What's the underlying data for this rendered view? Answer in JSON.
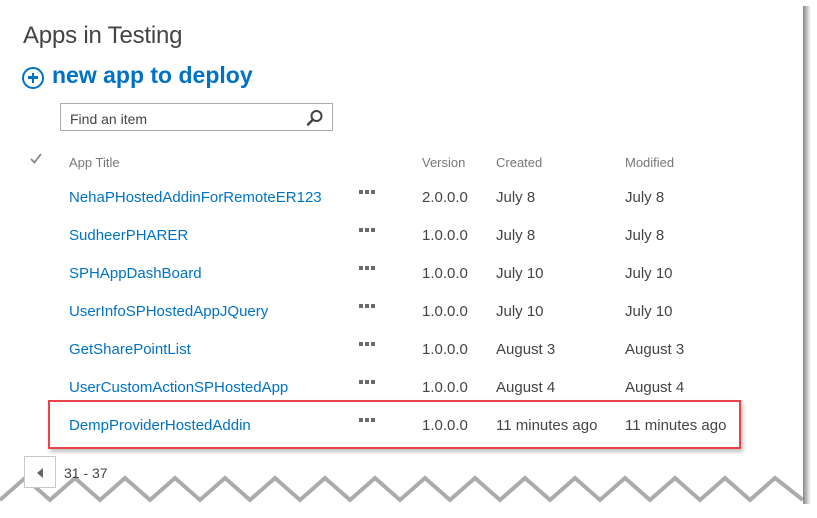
{
  "page": {
    "title": "Apps in Testing",
    "new_app_label": "new app to deploy"
  },
  "search": {
    "placeholder": "Find an item",
    "value": ""
  },
  "table": {
    "columns": {
      "title": "App Title",
      "version": "Version",
      "created": "Created",
      "modified": "Modified"
    },
    "rows": [
      {
        "title": "NehaPHostedAddinForRemoteER123",
        "version": "2.0.0.0",
        "created": "July 8",
        "modified": "July 8"
      },
      {
        "title": "SudheerPHARER",
        "version": "1.0.0.0",
        "created": "July 8",
        "modified": "July 8"
      },
      {
        "title": "SPHAppDashBoard",
        "version": "1.0.0.0",
        "created": "July 10",
        "modified": "July 10"
      },
      {
        "title": "UserInfoSPHostedAppJQuery",
        "version": "1.0.0.0",
        "created": "July 10",
        "modified": "July 10"
      },
      {
        "title": "GetSharePointList",
        "version": "1.0.0.0",
        "created": "August 3",
        "modified": "August 3"
      },
      {
        "title": "UserCustomActionSPHostedApp",
        "version": "1.0.0.0",
        "created": "August 4",
        "modified": "August 4"
      },
      {
        "title": "DempProviderHostedAddin",
        "version": "1.0.0.0",
        "created": "11 minutes ago",
        "modified": "11 minutes ago",
        "highlighted": true
      }
    ]
  },
  "pager": {
    "range": "31 - 37"
  },
  "colors": {
    "link": "#0072c6",
    "highlight_border": "#e8434a",
    "text": "#444444"
  }
}
